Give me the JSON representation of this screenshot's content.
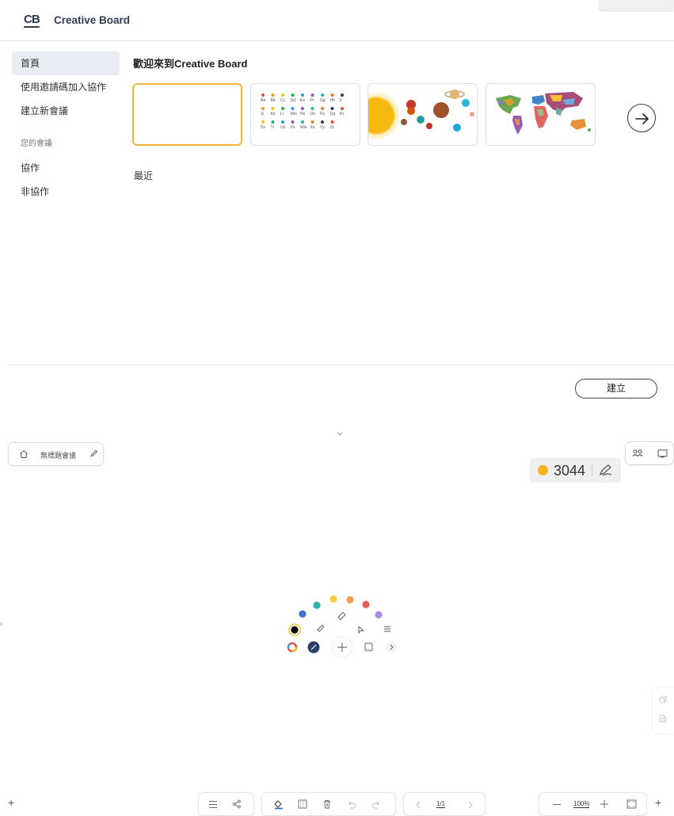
{
  "header": {
    "logo_text": "CB",
    "app_title": "Creative Board"
  },
  "sidebar": {
    "items": [
      {
        "label": "首頁"
      },
      {
        "label": "使用邀請碼加入協作"
      },
      {
        "label": "建立新會議"
      }
    ],
    "section_label": "您的會議",
    "sub_items": [
      {
        "label": "協作"
      },
      {
        "label": "非協作"
      }
    ]
  },
  "main": {
    "welcome": "歡迎來到Creative Board",
    "templates": [
      "blank",
      "alphabet",
      "solar-system",
      "world-map"
    ],
    "alphabet_rows": [
      [
        "Aa",
        "Bb",
        "Cc",
        "Dd",
        "Ee",
        "Ff",
        "Gg",
        "Hh",
        "Ii"
      ],
      [
        "Jj",
        "Kk",
        "Ll",
        "Mm",
        "Nn",
        "Oo",
        "Pp",
        "Qq",
        "Rr"
      ],
      [
        "Ss",
        "Tt",
        "Uu",
        "Vv",
        "Ww",
        "Xx",
        "Yy",
        "Zz"
      ]
    ],
    "recent_label": "最近",
    "create_button": "建立"
  },
  "board": {
    "home_bar": {
      "title": "無標題會議"
    },
    "score": {
      "value": "3044"
    },
    "palette_colors": [
      "#000000",
      "#3b74d8",
      "#2bb3a4",
      "#f4d03f",
      "#f39c53",
      "#e35d5d",
      "#a98be0"
    ],
    "page_indicator": "1/1",
    "zoom_level": "100%"
  },
  "icons": [
    "home-icon",
    "pencil-icon",
    "people-icon",
    "screen-icon",
    "pen-icon",
    "arrow-right-icon",
    "chevron-down-icon",
    "hamburger-icon",
    "share-icon",
    "fill-icon",
    "pattern-icon",
    "delete-icon",
    "undo-icon",
    "redo-icon",
    "minus-icon",
    "plus-icon",
    "fit-screen-icon"
  ]
}
